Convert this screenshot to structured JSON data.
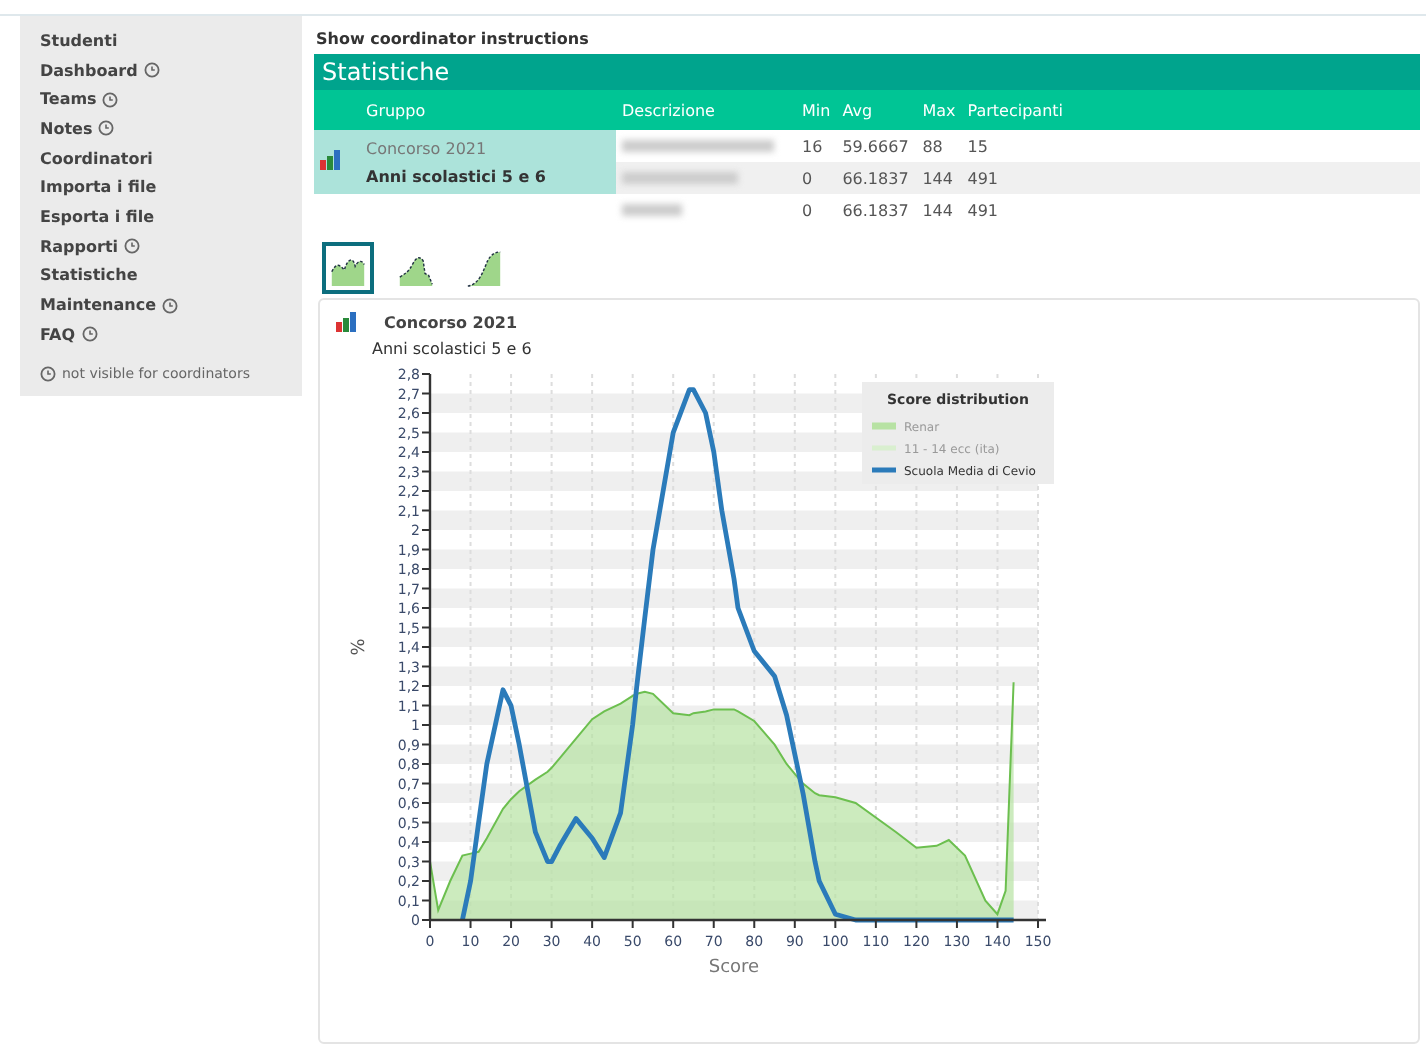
{
  "sidebar": {
    "items": [
      {
        "label": "Studenti",
        "restricted": false
      },
      {
        "label": "Dashboard",
        "restricted": true
      },
      {
        "label": "Teams",
        "restricted": true
      },
      {
        "label": "Notes",
        "restricted": true
      },
      {
        "label": "Coordinatori",
        "restricted": false
      },
      {
        "label": "Importa i file",
        "restricted": false
      },
      {
        "label": "Esporta i file",
        "restricted": false
      },
      {
        "label": "Rapporti",
        "restricted": true
      },
      {
        "label": "Statistiche",
        "restricted": false
      },
      {
        "label": "Maintenance",
        "restricted": true
      },
      {
        "label": "FAQ",
        "restricted": true
      }
    ],
    "note": "not visible for coordinators"
  },
  "instructions_link": "Show coordinator instructions",
  "table": {
    "title": "Statistiche",
    "columns": [
      "Gruppo",
      "Descrizione",
      "Min",
      "Avg",
      "Max",
      "Partecipanti"
    ],
    "group": {
      "name": "Concorso 2021",
      "years": "Anni scolastici 5 e 6",
      "selected": true
    },
    "rows": [
      {
        "min": "16",
        "avg": "59.6667",
        "max": "88",
        "partecipanti": "15"
      },
      {
        "min": "0",
        "avg": "66.1837",
        "max": "144",
        "partecipanti": "491"
      },
      {
        "min": "0",
        "avg": "66.1837",
        "max": "144",
        "partecipanti": "491"
      }
    ]
  },
  "chart_types": [
    {
      "kind": "density",
      "selected": true
    },
    {
      "kind": "histogram",
      "selected": false
    },
    {
      "kind": "cumulative",
      "selected": false
    }
  ],
  "chart": {
    "title": "Concorso 2021",
    "subtitle": "Anni scolastici 5 e 6",
    "chart_data": {
      "type": "area",
      "xlabel": "Score",
      "ylabel": "%",
      "grid": true,
      "legend": {
        "title": "Score distribution"
      },
      "x": [
        0,
        2,
        5,
        8,
        10,
        12,
        14,
        18,
        20,
        22,
        26,
        29,
        30,
        32,
        36,
        40,
        43,
        47,
        50,
        51,
        53,
        55,
        60,
        64,
        65,
        68,
        70,
        72,
        75,
        76,
        80,
        85,
        88,
        90,
        92,
        95,
        96,
        100,
        105,
        115,
        120,
        125,
        128,
        132,
        137,
        140,
        142,
        144
      ],
      "series": [
        {
          "name": "Renar",
          "color": "#b7e2a3",
          "values": [
            0.3,
            0.05,
            0.2,
            0.33,
            0.34,
            0.35,
            0.42,
            0.57,
            0.62,
            0.66,
            0.72,
            0.76,
            0.78,
            0.83,
            0.93,
            1.03,
            1.07,
            1.11,
            1.15,
            1.16,
            1.17,
            1.16,
            1.06,
            1.05,
            1.06,
            1.07,
            1.08,
            1.08,
            1.08,
            1.07,
            1.02,
            0.9,
            0.8,
            0.75,
            0.7,
            0.65,
            0.64,
            0.63,
            0.6,
            0.45,
            0.37,
            0.38,
            0.41,
            0.33,
            0.1,
            0.03,
            0.15,
            1.22
          ]
        },
        {
          "name": "11 - 14 ecc (ita)",
          "type": "line",
          "color": "#d9efcf",
          "values": [
            null,
            null,
            null,
            null,
            null,
            null,
            null,
            null,
            null,
            null,
            null,
            null,
            null,
            null,
            null,
            null,
            null,
            null,
            null,
            null,
            null,
            null,
            null,
            null,
            null,
            null,
            null,
            null,
            null,
            null,
            null,
            null,
            null,
            null,
            null,
            null,
            null,
            null,
            null,
            null,
            null,
            null,
            null,
            null,
            null,
            null,
            null,
            null
          ]
        },
        {
          "name": "Scuola Media di Cevio",
          "type": "line",
          "color": "#2b7bba",
          "values": [
            null,
            null,
            null,
            0,
            0.2,
            0.5,
            0.8,
            1.18,
            1.1,
            0.9,
            0.45,
            0.3,
            0.3,
            0.38,
            0.52,
            0.42,
            0.32,
            0.55,
            1.0,
            1.2,
            1.55,
            1.9,
            2.5,
            2.72,
            2.72,
            2.6,
            2.4,
            2.1,
            1.75,
            1.6,
            1.38,
            1.25,
            1.05,
            0.85,
            0.65,
            0.3,
            0.2,
            0.03,
            0,
            0,
            0,
            0,
            0,
            0,
            0,
            0,
            0,
            0
          ]
        }
      ],
      "xlim": [
        0,
        150
      ],
      "ylim": [
        0,
        2.8
      ],
      "xticks": [
        0,
        10,
        20,
        30,
        40,
        50,
        60,
        70,
        80,
        90,
        100,
        110,
        120,
        130,
        140,
        150
      ],
      "yticks": [
        0,
        {
          "value": 0.1,
          "label": "0,1"
        },
        {
          "value": 0.2,
          "label": "0,2"
        },
        {
          "value": 0.3,
          "label": "0,3"
        },
        {
          "value": 0.4,
          "label": "0,4"
        },
        {
          "value": 0.5,
          "label": "0,5"
        },
        {
          "value": 0.6,
          "label": "0,6"
        },
        {
          "value": 0.7,
          "label": "0,7"
        },
        {
          "value": 0.8,
          "label": "0,8"
        },
        {
          "value": 0.9,
          "label": "0,9"
        },
        1,
        {
          "value": 1.1,
          "label": "1,1"
        },
        {
          "value": 1.2,
          "label": "1,2"
        },
        {
          "value": 1.3,
          "label": "1,3"
        },
        {
          "value": 1.4,
          "label": "1,4"
        },
        {
          "value": 1.5,
          "label": "1,5"
        },
        {
          "value": 1.6,
          "label": "1,6"
        },
        {
          "value": 1.7,
          "label": "1,7"
        },
        {
          "value": 1.8,
          "label": "1,8"
        },
        {
          "value": 1.9,
          "label": "1,9"
        },
        2,
        {
          "value": 2.1,
          "label": "2,1"
        },
        {
          "value": 2.2,
          "label": "2,2"
        },
        {
          "value": 2.3,
          "label": "2,3"
        },
        {
          "value": 2.4,
          "label": "2,4"
        },
        {
          "value": 2.5,
          "label": "2,5"
        },
        {
          "value": 2.6,
          "label": "2,6"
        },
        {
          "value": 2.7,
          "label": "2,7"
        },
        {
          "value": 2.8,
          "label": "2,8"
        }
      ]
    }
  }
}
